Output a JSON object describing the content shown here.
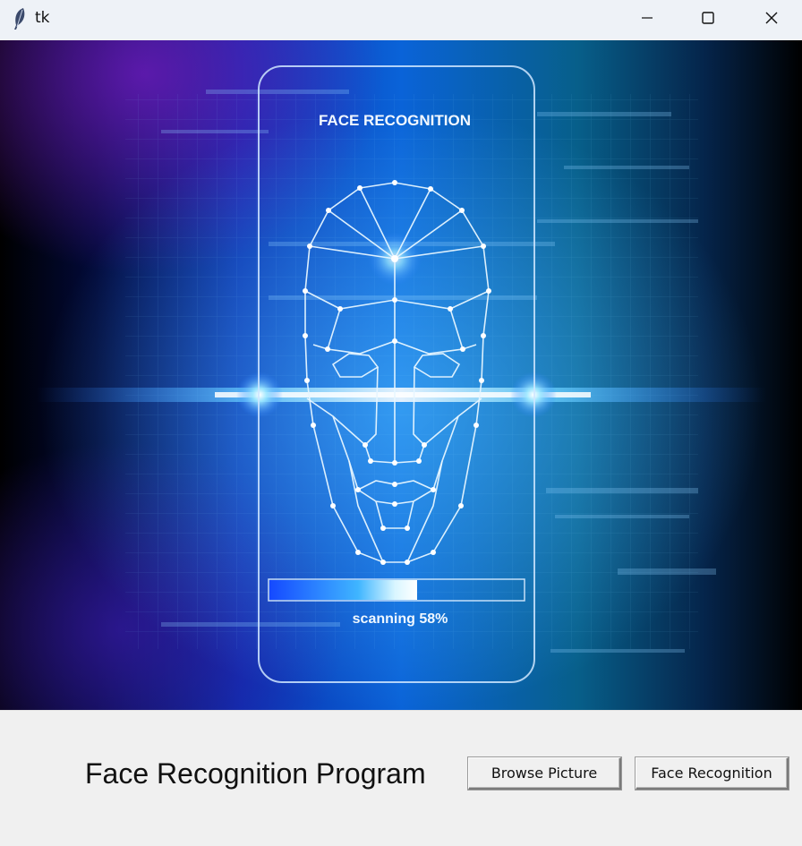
{
  "window": {
    "title": "tk",
    "controls": {
      "minimize": "minimize",
      "maximize": "maximize",
      "close": "close"
    }
  },
  "hero": {
    "panel_title": "FACE RECOGNITION",
    "status": "scanning 58%",
    "progress": 0.58
  },
  "footer": {
    "title": "Face Recognition Program",
    "browse_label": "Browse Picture",
    "recognize_label": "Face Recognition"
  },
  "colors": {
    "accent_blue": "#0a6cff",
    "glow": "#6fd6ff",
    "background": "#f0f0f0"
  }
}
